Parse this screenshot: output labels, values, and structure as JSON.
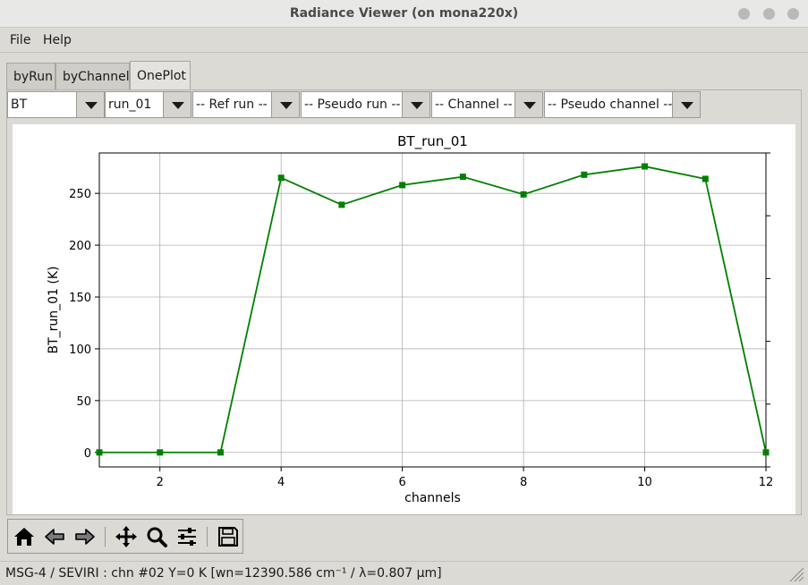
{
  "window": {
    "title": "Radiance Viewer (on mona220x)"
  },
  "menu": {
    "items": [
      "File",
      "Help"
    ]
  },
  "tabs": [
    {
      "label": "byRun",
      "active": false
    },
    {
      "label": "byChannel",
      "active": false
    },
    {
      "label": "OnePlot",
      "active": true
    }
  ],
  "selectors": {
    "quantity": "BT",
    "run": "run_01",
    "ref_run": "-- Ref run --",
    "pseudo_run": "-- Pseudo run --",
    "channel": "-- Channel --",
    "pseudo_channel": "-- Pseudo channel --"
  },
  "toolbar": {
    "icons": [
      "home-icon",
      "back-arrow-icon",
      "forward-arrow-icon",
      "pan-icon",
      "zoom-icon",
      "configure-subplots-icon",
      "save-icon"
    ]
  },
  "status": {
    "text": "MSG-4 / SEVIRI : chn #02 Y=0 K [wn=12390.586 cm⁻¹ / λ=0.807 μm]"
  },
  "colors": {
    "series": "#008000",
    "grid": "#b0b0b0"
  },
  "chart_data": {
    "type": "line",
    "title": "BT_run_01",
    "xlabel": "channels",
    "ylabel": "BT_run_01 (K)",
    "xlim": [
      1,
      12
    ],
    "ylim": [
      -14,
      289
    ],
    "xticks": [
      2,
      4,
      6,
      8,
      10,
      12
    ],
    "yticks": [
      0,
      50,
      100,
      150,
      200,
      250
    ],
    "grid": true,
    "marker": "square",
    "x": [
      1,
      2,
      3,
      4,
      5,
      6,
      7,
      8,
      9,
      10,
      11,
      12
    ],
    "series": [
      {
        "values": [
          0,
          0,
          0,
          265,
          239,
          258,
          266,
          249,
          268,
          276,
          264,
          0
        ]
      }
    ]
  }
}
